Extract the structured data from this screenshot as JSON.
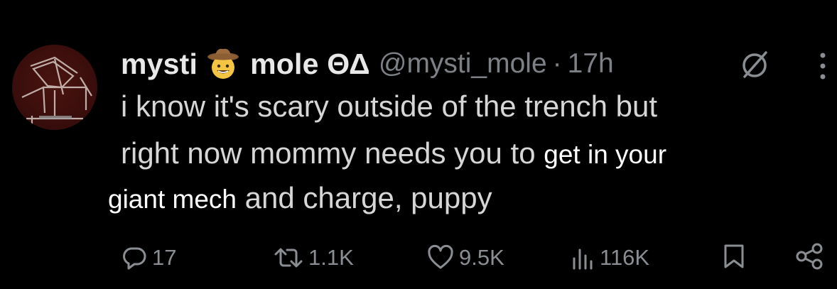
{
  "colors": {
    "background": "#000000",
    "primary_text": "#d6d6d6",
    "secondary_text": "#7d8186",
    "overlay_text": "#ffffff"
  },
  "tweet": {
    "display_name_part1": "mysti",
    "display_name_emoji": "cowboy-hat-face-icon",
    "display_name_part2": "mole ΘΔ",
    "handle": "@mysti_mole",
    "separator": "·",
    "time": "17h",
    "body_line1": "i know it's scary outside of the trench but",
    "body_line2_original": "right now mommy needs you to ",
    "body_line2_overlay": "get in your",
    "body_line3_overlay": "giant mech",
    "body_line3_original": " and charge, puppy"
  },
  "actions": {
    "reply_count": "17",
    "repost_count": "1.1K",
    "like_count": "9.5K",
    "views_count": "116K"
  },
  "icons": [
    "grok-icon",
    "more-icon",
    "reply-icon",
    "repost-icon",
    "like-icon",
    "views-icon",
    "bookmark-icon",
    "share-icon"
  ]
}
